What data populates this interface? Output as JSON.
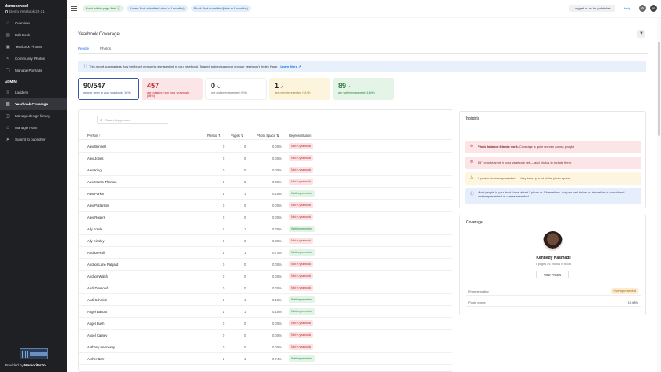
{
  "sidebar": {
    "school": "demoschool",
    "year": "Demo Yearbook 20-21",
    "items_top": [
      {
        "label": "Overview",
        "icon": "home-icon"
      },
      {
        "label": "Edit Book",
        "icon": "book-icon"
      },
      {
        "label": "Yearbook Photos",
        "icon": "image-icon"
      },
      {
        "label": "Community Photos",
        "icon": "share-icon"
      },
      {
        "label": "Manage Portraits",
        "icon": "portrait-icon"
      }
    ],
    "section": "ADMIN",
    "items_admin": [
      {
        "label": "Ladders",
        "icon": "ladder-icon"
      },
      {
        "label": "Yearbook Coverage",
        "icon": "coverage-icon",
        "active": true
      },
      {
        "label": "Manage design library",
        "icon": "palette-icon"
      },
      {
        "label": "Manage Team",
        "icon": "team-icon"
      },
      {
        "label": "Submit to publisher",
        "icon": "send-icon"
      }
    ],
    "provided_prefix": "Provided by",
    "provided_brand": "MemoriEsTo"
  },
  "topbar": {
    "pill1": "Book within page limit",
    "pill2": "Cover: Not submitted (due in 5 months)",
    "pill3": "Book: Not submitted (due in 5 months)",
    "logged_in": "Logged in as the publisher",
    "help": "Help",
    "avatar_initials": "JB"
  },
  "page": {
    "title": "Yearbook Coverage",
    "tabs": [
      "People",
      "Photos"
    ],
    "info_text": "This report summarizes how well each person is represented in your yearbook. Tagged subjects appear on your yearbook's Index Page.",
    "info_link": "Learn More"
  },
  "cards": [
    {
      "num": "90/547",
      "suffix": "",
      "label": "people seen in your yearbook (16%)"
    },
    {
      "num": "457",
      "suffix": "",
      "label": "are missing from your yearbook (84%)"
    },
    {
      "num": "0",
      "suffix": "↘",
      "label": "are underrepresented (0%)"
    },
    {
      "num": "1",
      "suffix": "↗",
      "label": "are overrepresented (<1%)"
    },
    {
      "num": "89",
      "suffix": "✓",
      "label": "are well represented (16%)"
    }
  ],
  "table": {
    "search_placeholder": "Search by person",
    "headers": {
      "person": "Person ↑",
      "photos": "Photos ⇅",
      "pages": "Pages ⇅",
      "space": "Photo Space ⇅",
      "rep": "Representation"
    },
    "rows": [
      {
        "name": "Alex Bennett",
        "photos": "0",
        "pages": "0",
        "space": "0.00%",
        "rep": "Not in yearbook",
        "status": "red"
      },
      {
        "name": "Alex Jones",
        "photos": "0",
        "pages": "0",
        "space": "0.00%",
        "rep": "Not in yearbook",
        "status": "red"
      },
      {
        "name": "Alex King",
        "photos": "0",
        "pages": "0",
        "space": "0.00%",
        "rep": "Not in yearbook",
        "status": "red"
      },
      {
        "name": "Alex Martin-Thomas",
        "photos": "0",
        "pages": "0",
        "space": "0.00%",
        "rep": "Not in yearbook",
        "status": "red"
      },
      {
        "name": "Alex Parker",
        "photos": "1",
        "pages": "1",
        "space": "0.18%",
        "rep": "Well represented",
        "status": "green"
      },
      {
        "name": "Alex Patterson",
        "photos": "0",
        "pages": "0",
        "space": "0.00%",
        "rep": "Not in yearbook",
        "status": "red"
      },
      {
        "name": "Alex Rogers",
        "photos": "0",
        "pages": "0",
        "space": "0.00%",
        "rep": "Not in yearbook",
        "status": "red"
      },
      {
        "name": "Ally Fowle",
        "photos": "1",
        "pages": "1",
        "space": "0.79%",
        "rep": "Well represented",
        "status": "green"
      },
      {
        "name": "Ally Kinsley",
        "photos": "0",
        "pages": "0",
        "space": "0.00%",
        "rep": "Not in yearbook",
        "status": "red"
      },
      {
        "name": "Anchor Hall",
        "photos": "1",
        "pages": "1",
        "space": "0.74%",
        "rep": "Well represented",
        "status": "green"
      },
      {
        "name": "Anchor Lane Palgard",
        "photos": "0",
        "pages": "0",
        "space": "0.00%",
        "rep": "Not in yearbook",
        "status": "red"
      },
      {
        "name": "Anchor Walsh",
        "photos": "0",
        "pages": "0",
        "space": "0.00%",
        "rep": "Not in yearbook",
        "status": "red"
      },
      {
        "name": "Andi Diamond",
        "photos": "0",
        "pages": "0",
        "space": "0.00%",
        "rep": "Not in yearbook",
        "status": "red"
      },
      {
        "name": "Andi Schmidt",
        "photos": "1",
        "pages": "1",
        "space": "0.18%",
        "rep": "Well represented",
        "status": "green"
      },
      {
        "name": "Angel Bartolo",
        "photos": "1",
        "pages": "1",
        "space": "0.18%",
        "rep": "Well represented",
        "status": "green"
      },
      {
        "name": "Angel Bush",
        "photos": "0",
        "pages": "0",
        "space": "0.00%",
        "rep": "Not in yearbook",
        "status": "red"
      },
      {
        "name": "Angel Carney",
        "photos": "0",
        "pages": "0",
        "space": "0.00%",
        "rep": "Not in yearbook",
        "status": "red"
      },
      {
        "name": "Anthony Hennessy",
        "photos": "0",
        "pages": "0",
        "space": "0.00%",
        "rep": "Not in yearbook",
        "status": "red"
      },
      {
        "name": "Archer Barr",
        "photos": "1",
        "pages": "1",
        "space": "0.74%",
        "rep": "Well represented",
        "status": "green"
      }
    ]
  },
  "insights": {
    "title": "Insights",
    "items": [
      {
        "text_bold": "Photo balance: Needs work.",
        "text": " Coverage is quite uneven across people.",
        "type": "red",
        "icon": "alert-icon"
      },
      {
        "text_bold": "",
        "text": "457 people aren't in your yearbook yet — add photos to include them.",
        "type": "red",
        "icon": "alert-icon"
      },
      {
        "text_bold": "",
        "text": "1 person is overrepresented — they take up a lot of the photo space.",
        "type": "yellow",
        "icon": "warning-icon"
      },
      {
        "text_bold": "",
        "text": "Most people in your book have about 1 photo or 1 formations. Anyone well below or above this is considered underrepresented or overrepresented.",
        "type": "blue",
        "icon": "info-icon"
      }
    ]
  },
  "coverage": {
    "title": "Coverage",
    "name": "Kennedy Kasmadi",
    "sub": "5 pages • 6 photos in book",
    "view_btn": "View Photos",
    "rep_key": "Representation",
    "rep_val": "Overrepresented",
    "space_key": "Photo space",
    "space_val": "12.08%"
  },
  "colors": {
    "sidebar_bg": "#1f2023",
    "accent": "#1a73e8",
    "red": "#b3262d",
    "green": "#2e7d3e"
  }
}
